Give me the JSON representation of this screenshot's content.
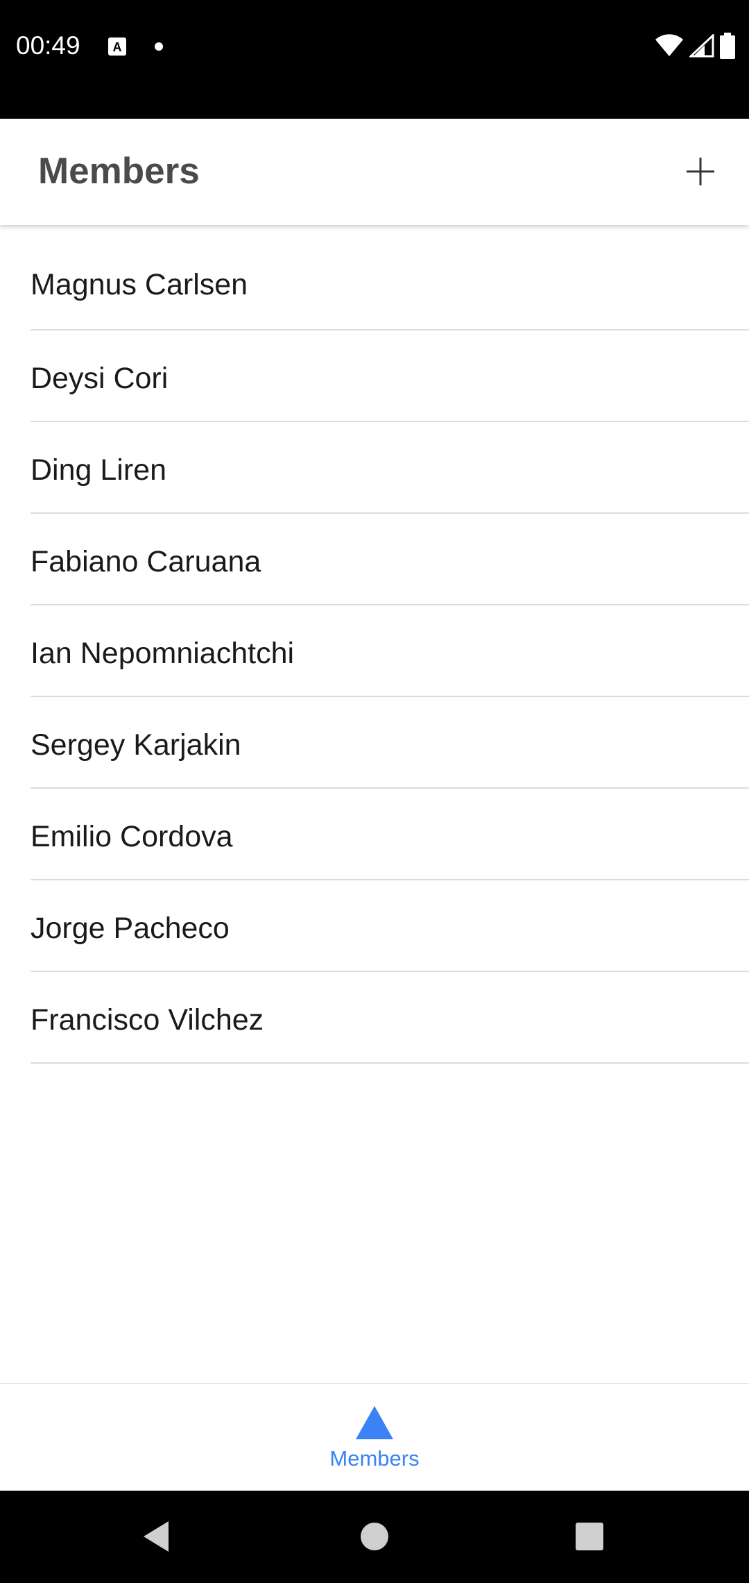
{
  "status_bar": {
    "time": "00:49",
    "icons": [
      "a-notification-icon",
      "dot-icon",
      "wifi-icon",
      "signal-icon",
      "battery-icon"
    ]
  },
  "app_bar": {
    "title": "Members",
    "action_icon": "plus-icon"
  },
  "members": [
    "Magnus Carlsen",
    "Deysi Cori",
    "Ding Liren",
    "Fabiano Caruana",
    "Ian Nepomniachtchi",
    "Sergey Karjakin",
    "Emilio Cordova",
    "Jorge Pacheco",
    "Francisco Vilchez"
  ],
  "bottom_nav": {
    "tabs": [
      {
        "label": "Members",
        "icon": "triangle-icon",
        "active": true
      }
    ]
  },
  "system_nav": {
    "icons": [
      "back-icon",
      "home-icon",
      "recents-icon"
    ]
  },
  "colors": {
    "accent": "#3b82f6",
    "title_text": "#4a4a4a",
    "list_text": "#1a1a1a",
    "divider": "#dcdcdc"
  }
}
